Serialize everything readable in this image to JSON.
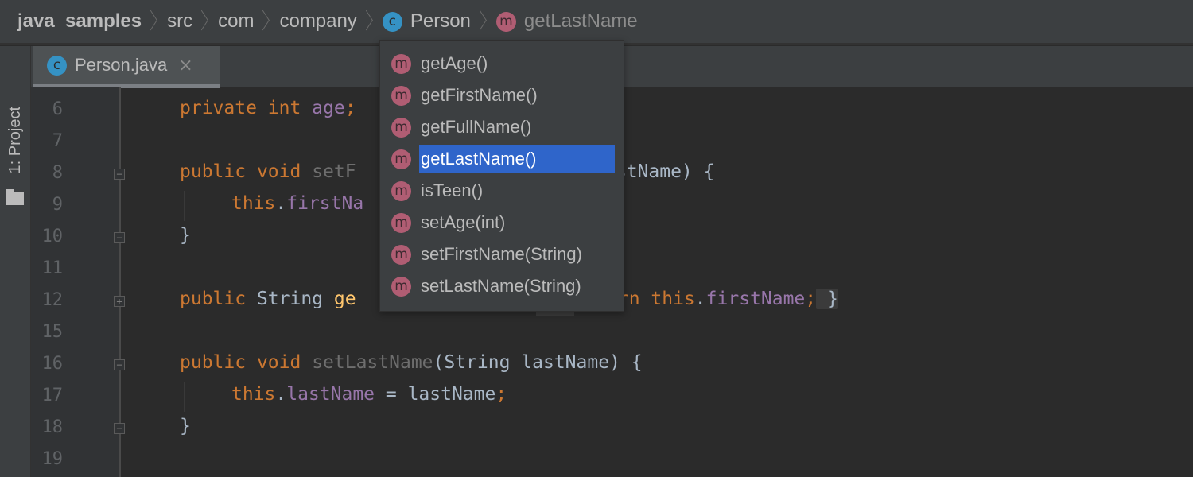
{
  "breadcrumbs": [
    {
      "label": "java_samples",
      "icon": null
    },
    {
      "label": "src",
      "icon": null
    },
    {
      "label": "com",
      "icon": null
    },
    {
      "label": "company",
      "icon": null
    },
    {
      "label": "Person",
      "icon": "class-icon",
      "badge": "c"
    },
    {
      "label": "getLastName",
      "icon": "method-icon",
      "badge": "m"
    }
  ],
  "sidebar": {
    "project_label": "1: Project"
  },
  "tab": {
    "label": "Person.java",
    "badge": "c",
    "close": "×"
  },
  "popup": {
    "items": [
      {
        "badge": "m",
        "label": "getAge()"
      },
      {
        "badge": "m",
        "label": "getFirstName()"
      },
      {
        "badge": "m",
        "label": "getFullName()"
      },
      {
        "badge": "m",
        "label": "getLastName()",
        "selected": true
      },
      {
        "badge": "m",
        "label": "isTeen()"
      },
      {
        "badge": "m",
        "label": "setAge(int)"
      },
      {
        "badge": "m",
        "label": "setFirstName(String)"
      },
      {
        "badge": "m",
        "label": "setLastName(String)"
      }
    ]
  },
  "editor": {
    "line_numbers": [
      "6",
      "7",
      "8",
      "9",
      "10",
      "11",
      "12",
      "15",
      "16",
      "17",
      "18",
      "19"
    ],
    "lines": {
      "l6": [
        "private",
        " int",
        " age",
        ";"
      ],
      "l8": [
        "public",
        " void",
        " setF",
        "",
        "rstName) {"
      ],
      "l9": [
        "this",
        ".",
        "firstNa"
      ],
      "l10": "}",
      "l12": [
        "public",
        " String",
        " ge",
        "urn",
        " this",
        ".",
        "firstName",
        ";",
        " }"
      ],
      "l16": [
        "public",
        " void",
        " setLastName",
        "(String lastName) {"
      ],
      "l17": [
        "this",
        ".",
        "lastName",
        " = lastName",
        ";"
      ],
      "l18": "}"
    }
  },
  "colors": {
    "keyword": "#cc7832",
    "field": "#9876aa",
    "method_decl": "#ffc66d",
    "selection": "#2f65ca",
    "class_badge": "#3592c4",
    "method_badge": "#b05d73"
  }
}
